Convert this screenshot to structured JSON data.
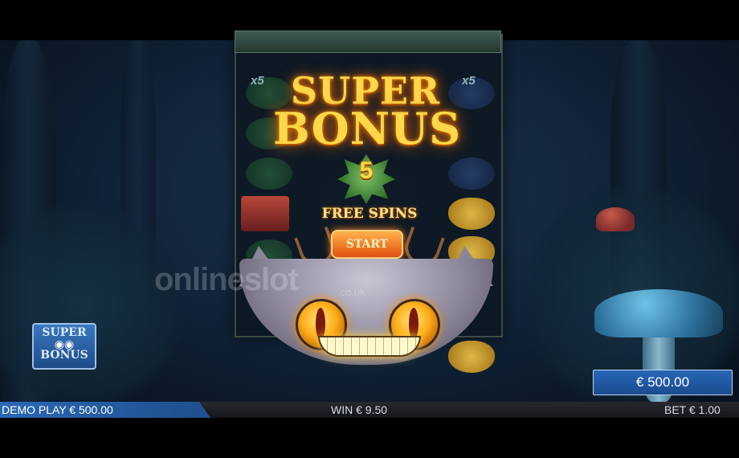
{
  "game": {
    "title_line1": "SUPER",
    "title_line2": "BONUS",
    "free_spins_count": "5",
    "free_spins_label": "FREE SPINS",
    "start_label": "START",
    "multiplier_left": "x5",
    "multiplier_right": "x5"
  },
  "watermark": {
    "main": "onlineslot",
    "sub": ".co.uk"
  },
  "badge": {
    "line1": "SUPER",
    "line2": "BONUS",
    "owl": "◉◉"
  },
  "balance": {
    "value": "€ 500.00"
  },
  "status_bar": {
    "demo": "DEMO PLAY € 500.00",
    "win": "WIN € 9.50",
    "bet": "BET € 1.00"
  },
  "colors": {
    "accent_gold": "#ffd84a",
    "button_orange": "#e2500e",
    "panel_blue": "#1f4f8c"
  },
  "icons": {
    "cat_mascot": "cat-mascot",
    "leaf": "leaf-icon",
    "antlers": "antler-icon"
  }
}
